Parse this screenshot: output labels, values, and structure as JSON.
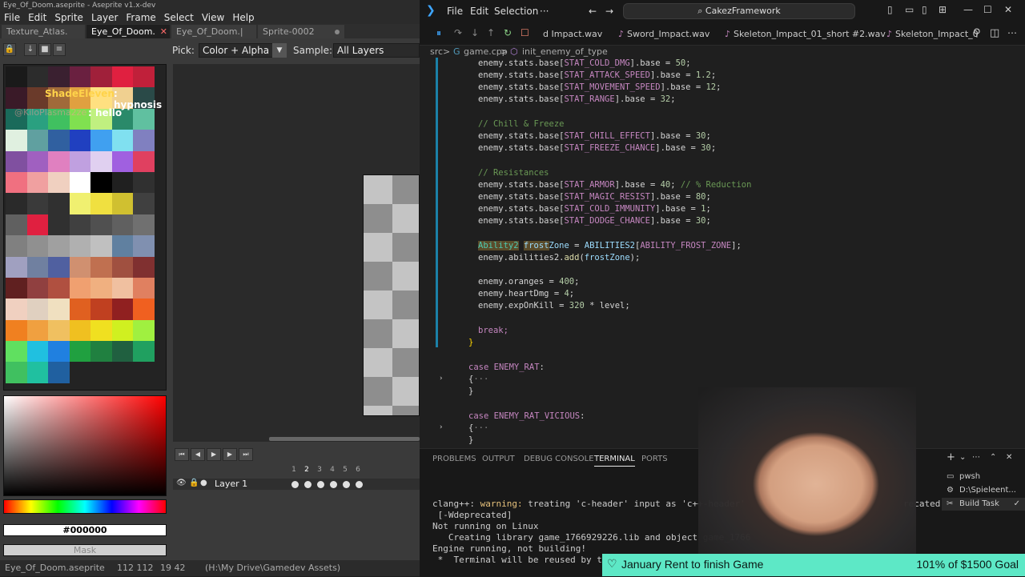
{
  "aseprite": {
    "window_title": "Eye_Of_Doom.aseprite - Aseprite v1.x-dev",
    "menu": [
      "File",
      "Edit",
      "Sprite",
      "Layer",
      "Frame",
      "Select",
      "View",
      "Help"
    ],
    "tabs": [
      {
        "label": "Texture_Atlas.",
        "active": false
      },
      {
        "label": "Eye_Of_Doom.",
        "active": true
      },
      {
        "label": "Eye_Of_Doom.|",
        "active": false
      },
      {
        "label": "Sprite-0002",
        "active": false
      }
    ],
    "pick_label": "Pick:",
    "pick_value": "Color + Alpha",
    "sample_label": "Sample:",
    "sample_value": "All Layers",
    "palette": [
      "#1a1a1a",
      "#2c2c2c",
      "#3a2030",
      "#6a2040",
      "#a0203a",
      "#e02040",
      "#c0203a",
      "#3a1a28",
      "#6a3a2a",
      "#a06a3a",
      "#e0a040",
      "#ffe080",
      "#f0d090",
      "#2a4a48",
      "#1a6a5a",
      "#2aa080",
      "#40c060",
      "#80e050",
      "#c0f080",
      "#2a8a6a",
      "#60c0a0",
      "#e0f0e0",
      "#60a0a0",
      "#3060a0",
      "#2040c0",
      "#40a0f0",
      "#80e0f0",
      "#8080c0",
      "#8050a0",
      "#a060c0",
      "#e080c0",
      "#c0a0e0",
      "#e0d0f0",
      "#a060e0",
      "#e04060",
      "#f07080",
      "#f0a0a0",
      "#f0d0c0",
      "#ffffff",
      "#000000",
      "#202020",
      "#303030",
      "#2a2a2a",
      "#3a3a3a",
      "#303030",
      "#f0f070",
      "#f0e040",
      "#d0c030",
      "#404040",
      "#606060",
      "#e02040",
      "#303030",
      "#404040",
      "#505050",
      "#606060",
      "#707070",
      "#808080",
      "#909090",
      "#a0a0a0",
      "#b0b0b0",
      "#c0c0c0",
      "#6080a0",
      "#8090b0",
      "#a0a0c0",
      "#7080a0",
      "#5060a0",
      "#d09070",
      "#c07050",
      "#a05040",
      "#803030",
      "#602020",
      "#904040",
      "#b05040",
      "#f0a070",
      "#f0b080",
      "#f0c0a0",
      "#e08060",
      "#f0d0c0",
      "#e0d0c0",
      "#f0e0c0",
      "#e06020",
      "#c04020",
      "#902020",
      "#f06020",
      "#f08020",
      "#f0a040",
      "#f0c060",
      "#f0c020",
      "#f0e020",
      "#d0f020",
      "#a0f040",
      "#60e060",
      "#20c0e0",
      "#2080e0",
      "#20a040",
      "#208040",
      "#206040",
      "#20a060",
      "#40c060",
      "#20c0a0",
      "#2060a0"
    ],
    "chat": {
      "user1": "ShadeEleven",
      "msg1": ": hypnosis",
      "user2": "@KiloPlasma2ze",
      "msg2": ": hello"
    },
    "hex_value": "#000000",
    "mask_label": "Mask",
    "frame_numbers": [
      "1",
      "2",
      "3",
      "4",
      "5",
      "6"
    ],
    "layer_name": "Layer 1",
    "status": {
      "file": "Eye_Of_Doom.aseprite",
      "size": "112 112",
      "pos": "19 42",
      "path": "(H:\\My Drive\\Gamedev Assets)"
    }
  },
  "vscode": {
    "menu": [
      "File",
      "Edit",
      "Selection",
      "···"
    ],
    "command_center": "CakezFramework",
    "tabs": [
      {
        "icon": "wav-icon",
        "label": "d Impact.wav"
      },
      {
        "icon": "wav-icon",
        "label": "Sword_Impact.wav"
      },
      {
        "icon": "wav-icon",
        "label": "Skeleton_Impact_01_short #2.wav"
      },
      {
        "icon": "wav-icon",
        "label": "Skeleton_Impact_0"
      }
    ],
    "breadcrumb": {
      "folder": "src",
      "sep": ">",
      "file": "game.cpp",
      "symbol": "init_enemy_of_type"
    },
    "panel_tabs": [
      {
        "label": "PROBLEMS",
        "active": false
      },
      {
        "label": "OUTPUT",
        "active": false
      },
      {
        "label": "DEBUG CONSOLE",
        "active": false
      },
      {
        "label": "TERMINAL",
        "active": true
      },
      {
        "label": "PORTS",
        "active": false
      }
    ],
    "terminal_lines": [
      {
        "a": "clang++: ",
        "w": "warning:",
        "b": " treating 'c-header' input as 'c++-header'",
        "tail": "recated"
      },
      {
        "a": " [-Wdeprecated]"
      },
      {
        "a": "Not running on Linux"
      },
      {
        "a": "   Creating library game_1766929226.lib and object game_1766"
      },
      {
        "a": "Engine running, not building!"
      },
      {
        "a": " *  Terminal will be reused by tas"
      }
    ],
    "terminal_list": [
      {
        "label": "pwsh",
        "selected": false
      },
      {
        "label": "D:\\Spieleent...",
        "selected": false
      },
      {
        "label": "Build Task",
        "selected": true
      }
    ]
  },
  "overlay": {
    "goal_text": "January Rent to finish Game",
    "goal_amount": "101% of $1500 Goal"
  },
  "colors": {
    "vscode_bg": "#1f1f1f",
    "aseprite_bg": "#3a3a3a",
    "goal_bar": "#5de8c6",
    "accent_blue": "#3ea6ff"
  }
}
